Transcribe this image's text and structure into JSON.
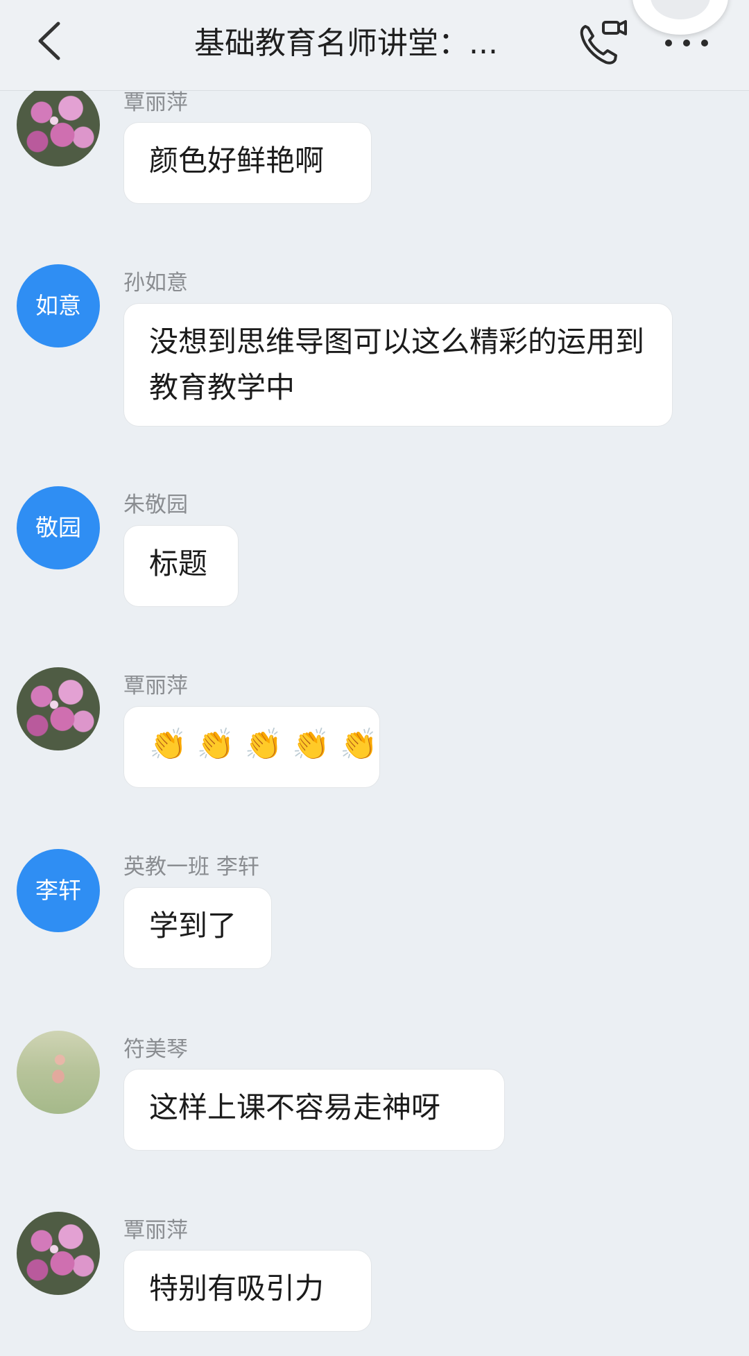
{
  "header": {
    "title": "基础教育名师讲堂：..."
  },
  "icons": {
    "back": "chevron-left-icon",
    "call": "phone-video-icon",
    "more": "more-dots-icon"
  },
  "messages": [
    {
      "sender": "覃丽萍",
      "text": "颜色好鲜艳啊",
      "avatar": "flower"
    },
    {
      "sender": "孙如意",
      "text": "没想到思维导图可以这么精彩的运用到教育教学中",
      "avatar_text": "如意"
    },
    {
      "sender": "朱敬园",
      "text": "标题",
      "avatar_text": "敬园"
    },
    {
      "sender": "覃丽萍",
      "emojis": [
        "👏",
        "👏",
        "👏",
        "👏",
        "👏"
      ],
      "avatar": "flower"
    },
    {
      "sender": "英教一班 李轩",
      "text": "学到了",
      "avatar_text": "李轩"
    },
    {
      "sender": "符美琴",
      "text": "这样上课不容易走神呀",
      "avatar": "meadow"
    },
    {
      "sender": "覃丽萍",
      "text": "特别有吸引力",
      "avatar": "flower"
    }
  ],
  "colors": {
    "background": "#ebeff3",
    "avatar_blue": "#2f8ef3",
    "bubble": "#ffffff",
    "sender_text": "#8a8d91"
  }
}
